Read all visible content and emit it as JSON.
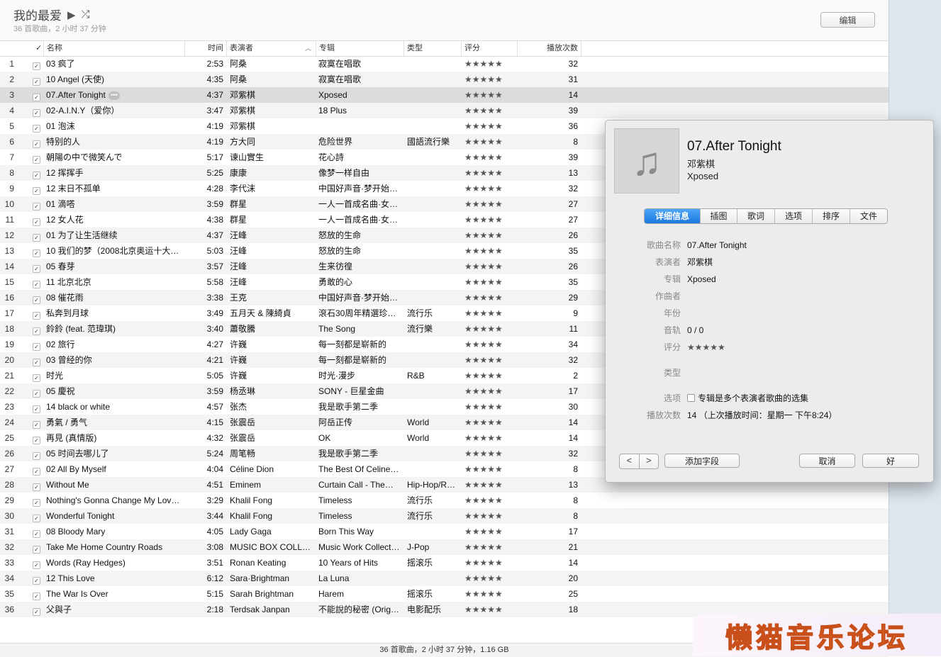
{
  "header": {
    "title": "我的最爱",
    "subtitle": "36 首歌曲，2 小时 37 分钟",
    "edit_label": "编辑"
  },
  "columns": {
    "check": "✓",
    "name": "名称",
    "time": "时间",
    "artist": "表演者",
    "album": "专辑",
    "genre": "类型",
    "rating": "评分",
    "plays": "播放次数"
  },
  "tracks": [
    {
      "i": "1",
      "name": "03 疯了",
      "time": "2:53",
      "artist": "阿桑",
      "album": "寂寞在唱歌",
      "genre": "",
      "rating": "★★★★★",
      "plays": "32"
    },
    {
      "i": "2",
      "name": "10 Angel (天使)",
      "time": "4:35",
      "artist": "阿桑",
      "album": "寂寞在唱歌",
      "genre": "",
      "rating": "★★★★★",
      "plays": "31"
    },
    {
      "i": "3",
      "name": "07.After Tonight",
      "time": "4:37",
      "artist": "邓紫棋",
      "album": "Xposed",
      "genre": "",
      "rating": "★★★★★",
      "plays": "14"
    },
    {
      "i": "4",
      "name": "02-A.I.N.Y（爱你）",
      "time": "3:47",
      "artist": "邓紫棋",
      "album": "18 Plus",
      "genre": "",
      "rating": "★★★★★",
      "plays": "39"
    },
    {
      "i": "5",
      "name": "01 泡沫",
      "time": "4:19",
      "artist": "邓紫棋",
      "album": "",
      "genre": "",
      "rating": "★★★★★",
      "plays": "36"
    },
    {
      "i": "6",
      "name": "特别的人",
      "time": "4:19",
      "artist": "方大同",
      "album": "危险世界",
      "genre": "國語流行樂",
      "rating": "★★★★★",
      "plays": "8"
    },
    {
      "i": "7",
      "name": "朝陽の中で微笑んで",
      "time": "5:17",
      "artist": "谏山實生",
      "album": "花心詩",
      "genre": "",
      "rating": "★★★★★",
      "plays": "39"
    },
    {
      "i": "8",
      "name": "12 挥挥手",
      "time": "5:25",
      "artist": "康康",
      "album": "像梦一样自由",
      "genre": "",
      "rating": "★★★★★",
      "plays": "13"
    },
    {
      "i": "9",
      "name": "12 末日不孤单",
      "time": "4:28",
      "artist": "李代沫",
      "album": "中国好声音·梦开始…",
      "genre": "",
      "rating": "★★★★★",
      "plays": "32"
    },
    {
      "i": "10",
      "name": "01 滴嗒",
      "time": "3:59",
      "artist": "群星",
      "album": "一人一首成名曲·女…",
      "genre": "",
      "rating": "★★★★★",
      "plays": "27"
    },
    {
      "i": "11",
      "name": "12 女人花",
      "time": "4:38",
      "artist": "群星",
      "album": "一人一首成名曲·女…",
      "genre": "",
      "rating": "★★★★★",
      "plays": "27"
    },
    {
      "i": "12",
      "name": "01 为了让生活继续",
      "time": "4:37",
      "artist": "汪峰",
      "album": "怒放的生命",
      "genre": "",
      "rating": "★★★★★",
      "plays": "26"
    },
    {
      "i": "13",
      "name": "10 我们的梦（2008北京奥运十大…",
      "time": "5:03",
      "artist": "汪峰",
      "album": "怒放的生命",
      "genre": "",
      "rating": "★★★★★",
      "plays": "35"
    },
    {
      "i": "14",
      "name": "05 春芽",
      "time": "3:57",
      "artist": "汪峰",
      "album": "生来彷徨",
      "genre": "",
      "rating": "★★★★★",
      "plays": "26"
    },
    {
      "i": "15",
      "name": "11 北京北京",
      "time": "5:58",
      "artist": "汪峰",
      "album": "勇敢的心",
      "genre": "",
      "rating": "★★★★★",
      "plays": "35"
    },
    {
      "i": "16",
      "name": "08 催花雨",
      "time": "3:38",
      "artist": "王克",
      "album": "中国好声音·梦开始…",
      "genre": "",
      "rating": "★★★★★",
      "plays": "29"
    },
    {
      "i": "17",
      "name": "私奔到月球",
      "time": "3:49",
      "artist": "五月天 & 陳綺貞",
      "album": "滾石30周年精選珍…",
      "genre": "流行乐",
      "rating": "★★★★★",
      "plays": "9"
    },
    {
      "i": "18",
      "name": "鈴鈴 (feat. 范瑋琪)",
      "time": "3:40",
      "artist": "蕭敬騰",
      "album": "The Song",
      "genre": "流行樂",
      "rating": "★★★★★",
      "plays": "11"
    },
    {
      "i": "19",
      "name": "02 旅行",
      "time": "4:27",
      "artist": "许巍",
      "album": "每一刻都是崭新的",
      "genre": "",
      "rating": "★★★★★",
      "plays": "34"
    },
    {
      "i": "20",
      "name": "03 曾经的你",
      "time": "4:21",
      "artist": "许巍",
      "album": "每一刻都是崭新的",
      "genre": "",
      "rating": "★★★★★",
      "plays": "32"
    },
    {
      "i": "21",
      "name": "时光",
      "time": "5:05",
      "artist": "许巍",
      "album": "时光·漫步",
      "genre": "R&B",
      "rating": "★★★★★",
      "plays": "2"
    },
    {
      "i": "22",
      "name": "05 慶祝",
      "time": "3:59",
      "artist": "杨丞琳",
      "album": "SONY - 巨星金曲",
      "genre": "",
      "rating": "★★★★★",
      "plays": "17"
    },
    {
      "i": "23",
      "name": "14 black or white",
      "time": "4:57",
      "artist": "张杰",
      "album": "我是歌手第二季",
      "genre": "",
      "rating": "★★★★★",
      "plays": "30"
    },
    {
      "i": "24",
      "name": "勇氣 / 勇气",
      "time": "4:15",
      "artist": "张震岳",
      "album": "阿岳正传",
      "genre": "World",
      "rating": "★★★★★",
      "plays": "14"
    },
    {
      "i": "25",
      "name": "再見 (真情版)",
      "time": "4:32",
      "artist": "张震岳",
      "album": "OK",
      "genre": "World",
      "rating": "★★★★★",
      "plays": "14"
    },
    {
      "i": "26",
      "name": "05 时间去哪儿了",
      "time": "5:24",
      "artist": "周笔畅",
      "album": "我是歌手第二季",
      "genre": "",
      "rating": "★★★★★",
      "plays": "32"
    },
    {
      "i": "27",
      "name": "02 All By Myself",
      "time": "4:04",
      "artist": "Céline Dion",
      "album": "The Best Of Celine…",
      "genre": "",
      "rating": "★★★★★",
      "plays": "8"
    },
    {
      "i": "28",
      "name": "Without Me",
      "time": "4:51",
      "artist": "Eminem",
      "album": "Curtain Call - The…",
      "genre": "Hip-Hop/R…",
      "rating": "★★★★★",
      "plays": "13"
    },
    {
      "i": "29",
      "name": "Nothing's Gonna Change My Lov…",
      "time": "3:29",
      "artist": "Khalil Fong",
      "album": "Timeless",
      "genre": "流行乐",
      "rating": "★★★★★",
      "plays": "8"
    },
    {
      "i": "30",
      "name": "Wonderful Tonight",
      "time": "3:44",
      "artist": "Khalil Fong",
      "album": "Timeless",
      "genre": "流行乐",
      "rating": "★★★★★",
      "plays": "8"
    },
    {
      "i": "31",
      "name": "08 Bloody Mary",
      "time": "4:05",
      "artist": "Lady Gaga",
      "album": "Born This Way",
      "genre": "",
      "rating": "★★★★★",
      "plays": "17"
    },
    {
      "i": "32",
      "name": "Take Me Home Country Roads",
      "time": "3:08",
      "artist": "MUSIC BOX COLL…",
      "album": "Music Work Collect…",
      "genre": "J-Pop",
      "rating": "★★★★★",
      "plays": "21"
    },
    {
      "i": "33",
      "name": "Words (Ray Hedges)",
      "time": "3:51",
      "artist": "Ronan Keating",
      "album": "10 Years of Hits",
      "genre": "摇滚乐",
      "rating": "★★★★★",
      "plays": "14"
    },
    {
      "i": "34",
      "name": "12 This Love",
      "time": "6:12",
      "artist": "Sara·Brightman",
      "album": "La Luna",
      "genre": "",
      "rating": "★★★★★",
      "plays": "20"
    },
    {
      "i": "35",
      "name": "The War Is Over",
      "time": "5:15",
      "artist": "Sarah Brightman",
      "album": "Harem",
      "genre": "摇滚乐",
      "rating": "★★★★★",
      "plays": "25"
    },
    {
      "i": "36",
      "name": "父與子",
      "time": "2:18",
      "artist": "Terdsak Janpan",
      "album": "不能說的秘密 (Origi…",
      "genre": "电影配乐",
      "rating": "★★★★★",
      "plays": "18"
    }
  ],
  "selected_index": 2,
  "footer": {
    "summary": "36 首歌曲，2 小时 37 分钟，1.16 GB"
  },
  "watermark": {
    "text": "懒猫音乐论坛"
  },
  "dialog": {
    "title": "07.After Tonight",
    "artist": "邓紫棋",
    "album": "Xposed",
    "tabs": [
      "详细信息",
      "插图",
      "歌词",
      "选项",
      "排序",
      "文件"
    ],
    "active_tab": 0,
    "fields": {
      "song_name_label": "歌曲名称",
      "song_name": "07.After Tonight",
      "artist_label": "表演者",
      "artist": "邓紫棋",
      "album_label": "专辑",
      "album": "Xposed",
      "composer_label": "作曲者",
      "composer": "",
      "year_label": "年份",
      "year": "",
      "track_label": "音轨",
      "track": "0 / 0",
      "rating_label": "评分",
      "rating": "★★★★★",
      "genre_label": "类型",
      "genre": "",
      "options_label": "选项",
      "compilation": "专辑是多个表演者歌曲的选集",
      "plays_label": "播放次数",
      "plays": "14 （上次播放时间：星期一 下午8:24）"
    },
    "buttons": {
      "add_field": "添加字段",
      "cancel": "取消",
      "ok": "好",
      "prev": "<",
      "next": ">"
    }
  }
}
